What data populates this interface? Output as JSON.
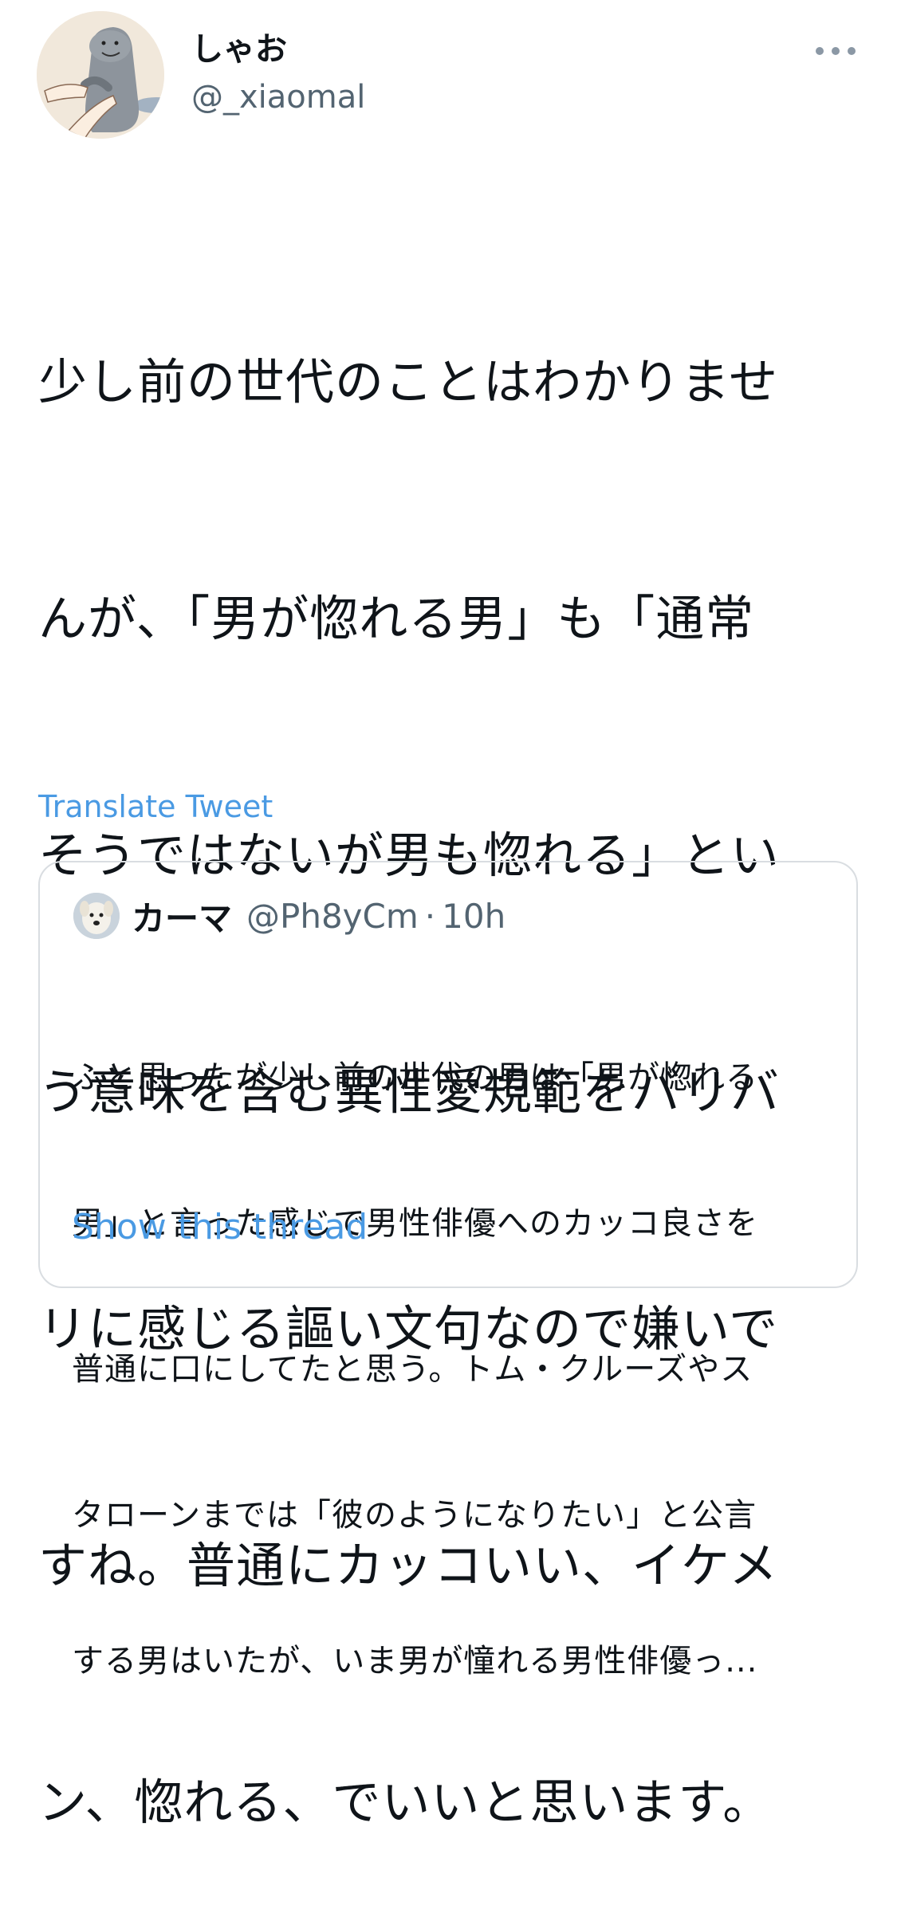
{
  "tweet": {
    "author": {
      "display_name": "しゃお",
      "handle": "@_xiaomal"
    },
    "text_lines": [
      "少し前の世代のことはわかりませ",
      "んが、「男が惚れる男」も「通常",
      "そうではないが男も惚れる」とい",
      "う意味を含む異性愛規範をバリバ",
      "リに感じる謳い文句なので嫌いで",
      "すね。普通にカッコいい、イケメ",
      "ン、惚れる、でいいと思います。"
    ],
    "translate_label": "Translate Tweet"
  },
  "quoted_tweet": {
    "display_name": "カーマ",
    "handle": "@Ph8yCm",
    "separator": "·",
    "time": "10h",
    "text_lines": [
      "ふと思ったが少し前の世代の男は「男が惚れる",
      "男」と言った感じで男性俳優へのカッコ良さを",
      "普通に口にしてたと思う。トム・クルーズやス",
      "タローンまでは「彼のようになりたい」と公言",
      "する男はいたが、いま男が憧れる男性俳優っ..."
    ],
    "show_thread_label": "Show this thread"
  },
  "colors": {
    "link": "#4a9ae3",
    "secondary_text": "#536471",
    "border": "#d9dde1"
  },
  "icons": {
    "more": "more-horizontal-icon"
  }
}
